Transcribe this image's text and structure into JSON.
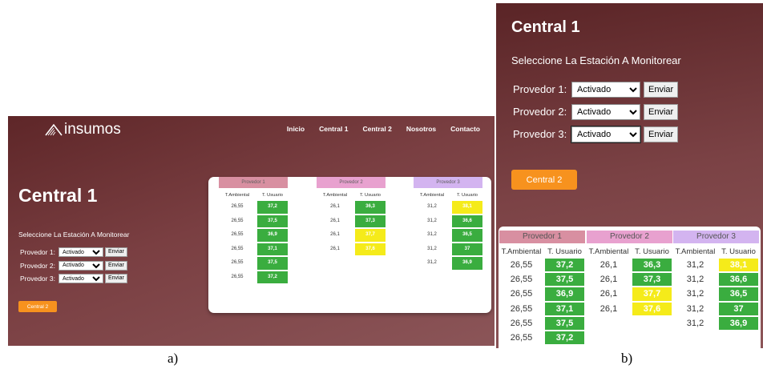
{
  "panel_a": {
    "logo": "insumos",
    "nav": [
      "Inicio",
      "Central 1",
      "Central 2",
      "Nosotros",
      "Contacto"
    ],
    "title": "Central 1",
    "subtitle": "Seleccione La Estación A Monitorear",
    "providers": [
      {
        "label": "Provedor 1:",
        "value": "Activado",
        "button": "Enviar"
      },
      {
        "label": "Provedor 2:",
        "value": "Activado",
        "button": "Enviar"
      },
      {
        "label": "Provedor 3:",
        "value": "Activado",
        "button": "Enviar"
      }
    ],
    "central2_button": "Central 2"
  },
  "panel_b": {
    "title": "Central 1",
    "subtitle": "Seleccione La Estación A Monitorear",
    "providers": [
      {
        "label": "Provedor 1:",
        "value": "Activado",
        "button": "Enviar"
      },
      {
        "label": "Provedor 2:",
        "value": "Activado",
        "button": "Enviar"
      },
      {
        "label": "Provedor 3:",
        "value": "Activado",
        "button": "Enviar"
      }
    ],
    "central2_button": "Central 2"
  },
  "table": {
    "col_ambient": "T.Ambiental",
    "col_user": "T. Usuario",
    "groups": [
      {
        "name": "Provedor 1",
        "header_color": "#d88fa1",
        "rows": [
          {
            "amb": "26,55",
            "user": "37,2",
            "status": "green"
          },
          {
            "amb": "26,55",
            "user": "37,5",
            "status": "green"
          },
          {
            "amb": "26,55",
            "user": "36,9",
            "status": "green"
          },
          {
            "amb": "26,55",
            "user": "37,1",
            "status": "green"
          },
          {
            "amb": "26,55",
            "user": "37,5",
            "status": "green"
          },
          {
            "amb": "26,55",
            "user": "37,2",
            "status": "green"
          }
        ]
      },
      {
        "name": "Provedor 2",
        "header_color": "#e8a1cf",
        "rows": [
          {
            "amb": "26,1",
            "user": "36,3",
            "status": "green"
          },
          {
            "amb": "26,1",
            "user": "37,3",
            "status": "green"
          },
          {
            "amb": "26,1",
            "user": "37,7",
            "status": "yellow"
          },
          {
            "amb": "26,1",
            "user": "37,6",
            "status": "yellow"
          }
        ]
      },
      {
        "name": "Provedor 3",
        "header_color": "#d3b4f0",
        "rows": [
          {
            "amb": "31,2",
            "user": "38,1",
            "status": "yellow"
          },
          {
            "amb": "31,2",
            "user": "36,6",
            "status": "green"
          },
          {
            "amb": "31,2",
            "user": "36,5",
            "status": "green"
          },
          {
            "amb": "31,2",
            "user": "37",
            "status": "green"
          },
          {
            "amb": "31,2",
            "user": "36,9",
            "status": "green"
          }
        ]
      }
    ]
  },
  "colors": {
    "green": "#3aad3f",
    "yellow": "#f5eb1a",
    "orange": "#f7921e"
  },
  "captions": [
    "a)",
    "b)"
  ]
}
